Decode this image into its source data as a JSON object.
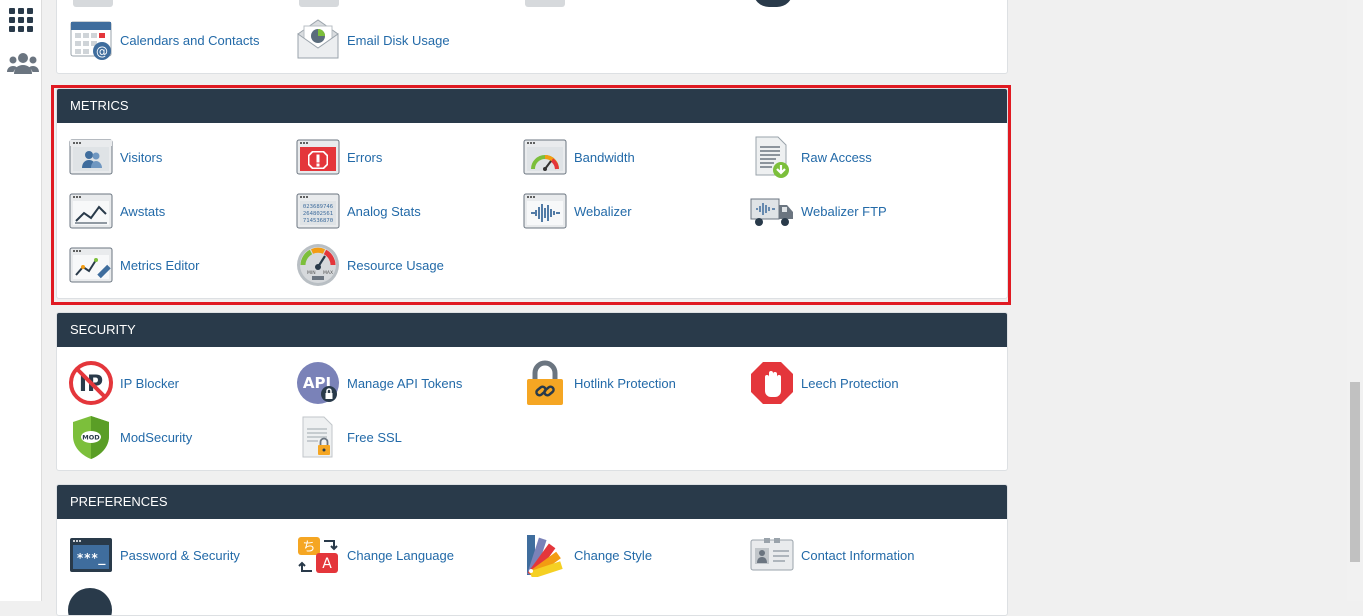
{
  "sidebar": {
    "items": [
      {
        "name": "grid-menu-icon"
      },
      {
        "name": "users-icon"
      }
    ]
  },
  "email_partial": {
    "items": [
      {
        "label": "Calendars and Contacts",
        "icon": "calendar-contacts-icon"
      },
      {
        "label": "Email Disk Usage",
        "icon": "email-disk-usage-icon"
      }
    ]
  },
  "metrics": {
    "title": "METRICS",
    "items": [
      {
        "label": "Visitors",
        "icon": "visitors-icon"
      },
      {
        "label": "Errors",
        "icon": "errors-icon"
      },
      {
        "label": "Bandwidth",
        "icon": "bandwidth-icon"
      },
      {
        "label": "Raw Access",
        "icon": "raw-access-icon"
      },
      {
        "label": "Awstats",
        "icon": "awstats-icon"
      },
      {
        "label": "Analog Stats",
        "icon": "analog-stats-icon"
      },
      {
        "label": "Webalizer",
        "icon": "webalizer-icon"
      },
      {
        "label": "Webalizer FTP",
        "icon": "webalizer-ftp-icon"
      },
      {
        "label": "Metrics Editor",
        "icon": "metrics-editor-icon"
      },
      {
        "label": "Resource Usage",
        "icon": "resource-usage-icon"
      }
    ],
    "analog_digits": [
      "023689746",
      "264802561",
      "714536870"
    ],
    "resource_gauge_labels": [
      "MIN",
      "MAX"
    ]
  },
  "security": {
    "title": "SECURITY",
    "items": [
      {
        "label": "IP Blocker",
        "icon": "ip-blocker-icon"
      },
      {
        "label": "Manage API Tokens",
        "icon": "api-tokens-icon"
      },
      {
        "label": "Hotlink Protection",
        "icon": "hotlink-protection-icon"
      },
      {
        "label": "Leech Protection",
        "icon": "leech-protection-icon"
      },
      {
        "label": "ModSecurity",
        "icon": "modsecurity-icon"
      },
      {
        "label": "Free SSL",
        "icon": "free-ssl-icon"
      }
    ],
    "ip_text": "IP",
    "api_text": "API",
    "mod_text": "MOD"
  },
  "preferences": {
    "title": "PREFERENCES",
    "items": [
      {
        "label": "Password & Security",
        "icon": "password-security-icon"
      },
      {
        "label": "Change Language",
        "icon": "change-language-icon"
      },
      {
        "label": "Change Style",
        "icon": "change-style-icon"
      },
      {
        "label": "Contact Information",
        "icon": "contact-information-icon"
      }
    ],
    "password_text": "***_",
    "language_glyphs": [
      "ち",
      "A"
    ]
  },
  "colors": {
    "header_bg": "#293a4a",
    "link": "#236aa8",
    "highlight": "#e01a22"
  }
}
